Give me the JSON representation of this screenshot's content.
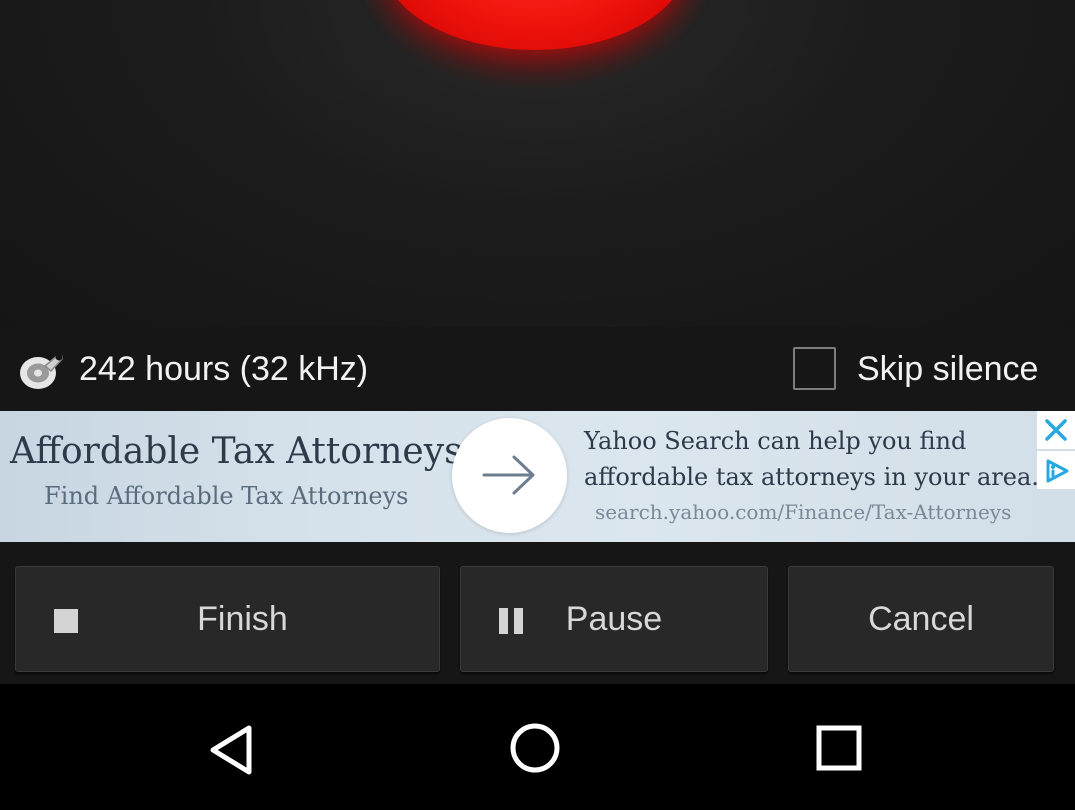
{
  "recorder": {
    "duration_text": "242 hours (32 kHz)",
    "skip_silence_label": "Skip silence",
    "skip_silence_checked": false,
    "storage_icon": "disk-wrench-icon",
    "record_button_color": "#f0140c"
  },
  "ad": {
    "title": "Affordable Tax Attorneys",
    "subtitle": "Find Affordable Tax Attorneys",
    "description": "Yahoo Search can help you find\naffordable tax attorneys in your area.",
    "url": "search.yahoo.com/Finance/Tax-Attorneys",
    "arrow_icon": "arrow-right-icon",
    "close_icon": "close-icon",
    "adchoices_icon": "adchoices-icon",
    "accent_color": "#27a8e0"
  },
  "actions": {
    "finish_label": "Finish",
    "pause_label": "Pause",
    "cancel_label": "Cancel"
  },
  "nav": {
    "back_icon": "back-triangle-icon",
    "home_icon": "home-circle-icon",
    "recents_icon": "recents-square-icon"
  }
}
